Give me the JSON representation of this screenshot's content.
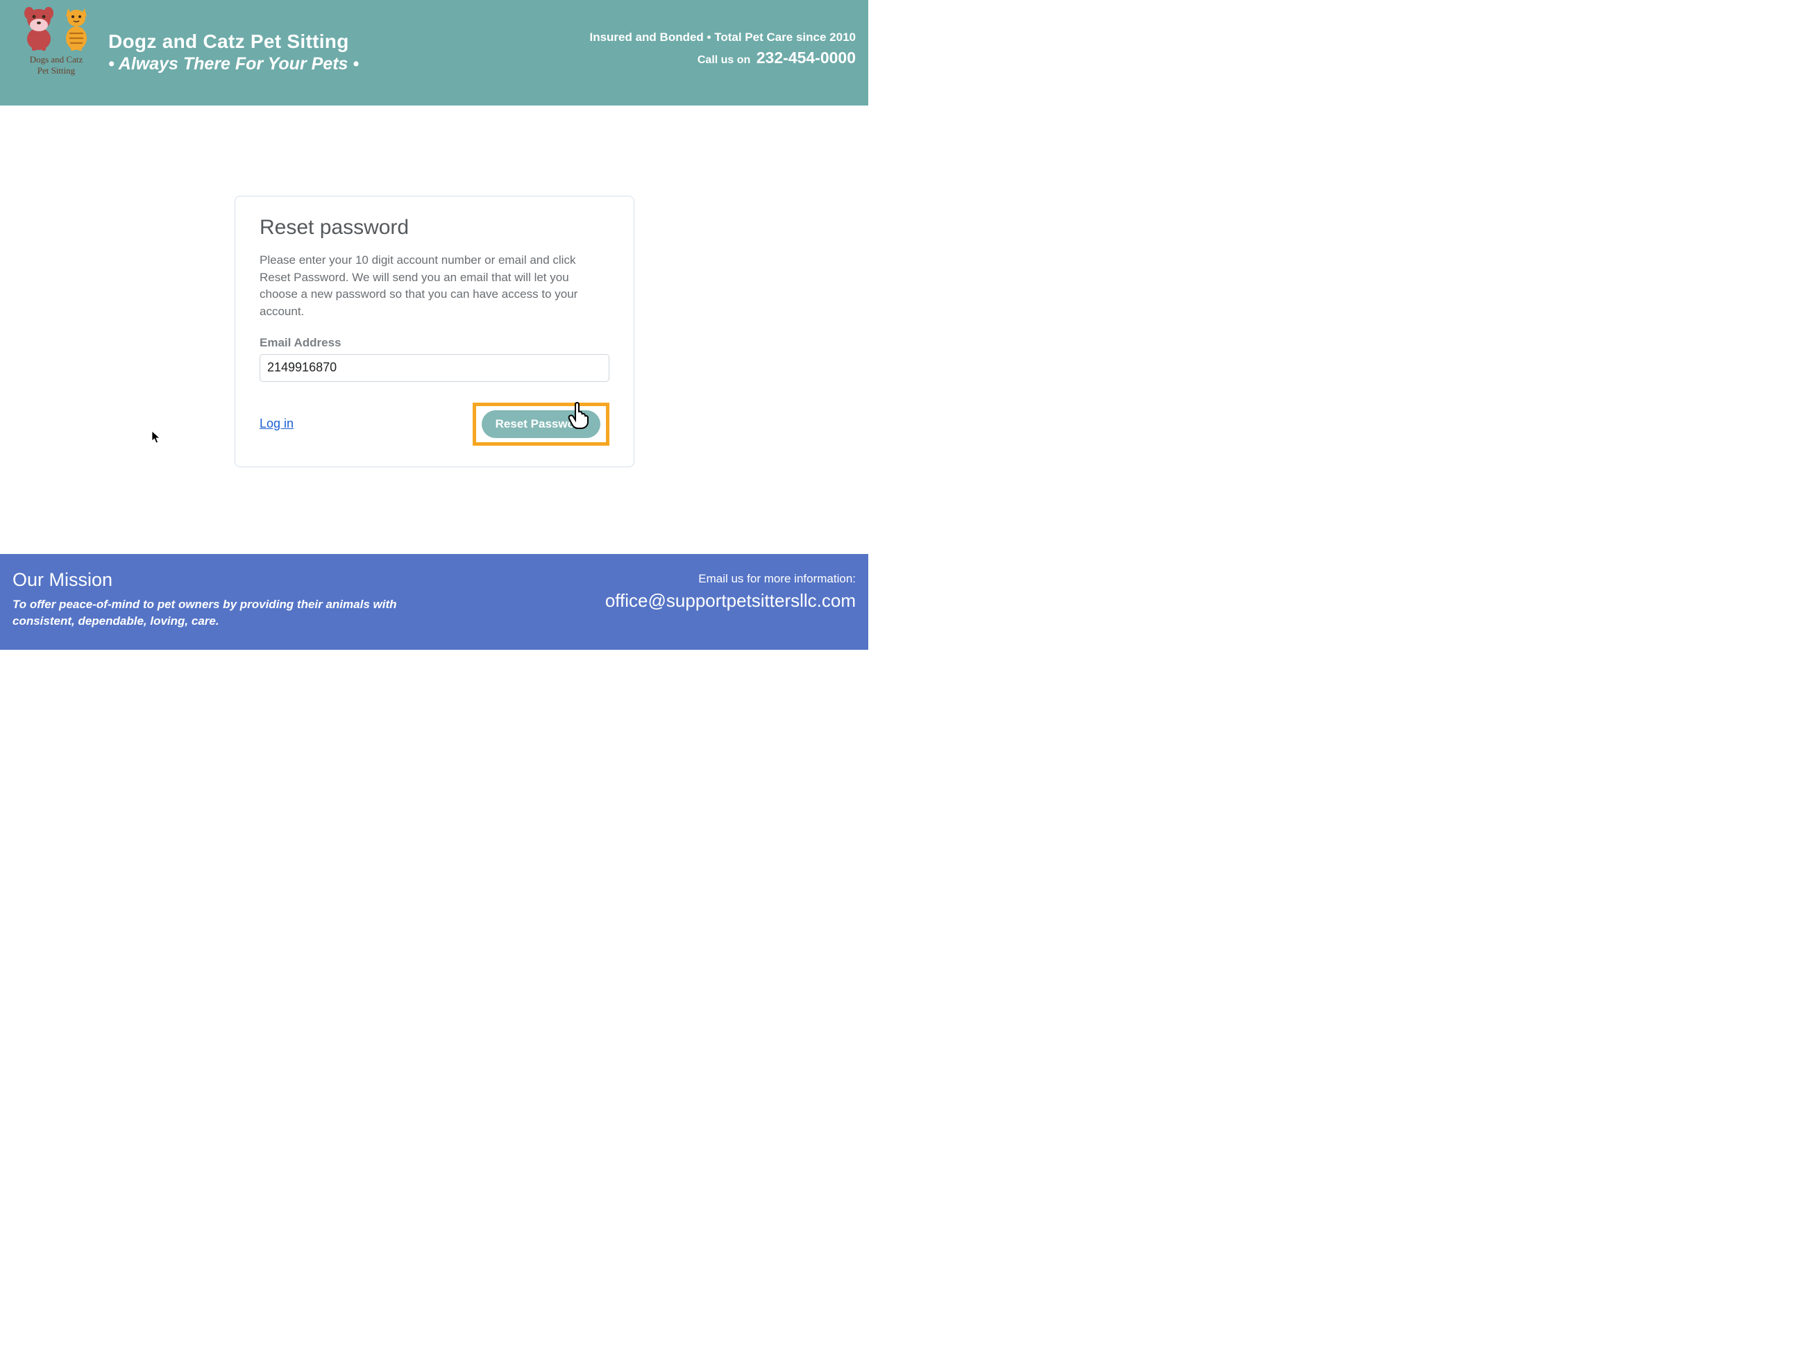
{
  "header": {
    "logo_text_1": "Dogs and Catz",
    "logo_text_2": "Pet Sitting",
    "title": "Dogz and Catz Pet Sitting",
    "subtitle": "• Always There For Your Pets  •",
    "tagline": "Insured and Bonded • Total Pet Care since 2010",
    "call_label": "Call us on",
    "phone": "232-454-0000"
  },
  "card": {
    "title": "Reset password",
    "description": "Please enter your 10 digit account number or email and click Reset Password. We will send you an email that will let you choose a new password so that you can have access to your account.",
    "field_label": "Email Address",
    "field_value": "2149916870",
    "login_link": "Log in",
    "reset_button": "Reset Password"
  },
  "footer": {
    "mission_title": "Our Mission",
    "mission_text": "To offer peace-of-mind to pet owners by providing their animals with consistent, dependable, loving, care.",
    "email_label": "Email us for more information:",
    "email": "office@supportpetsittersllc.com"
  },
  "colors": {
    "header_bg": "#6eaba9",
    "footer_bg": "#5574c6",
    "accent_highlight": "#f5a623",
    "button_bg": "#83b8b6",
    "link": "#1a5fd0"
  }
}
